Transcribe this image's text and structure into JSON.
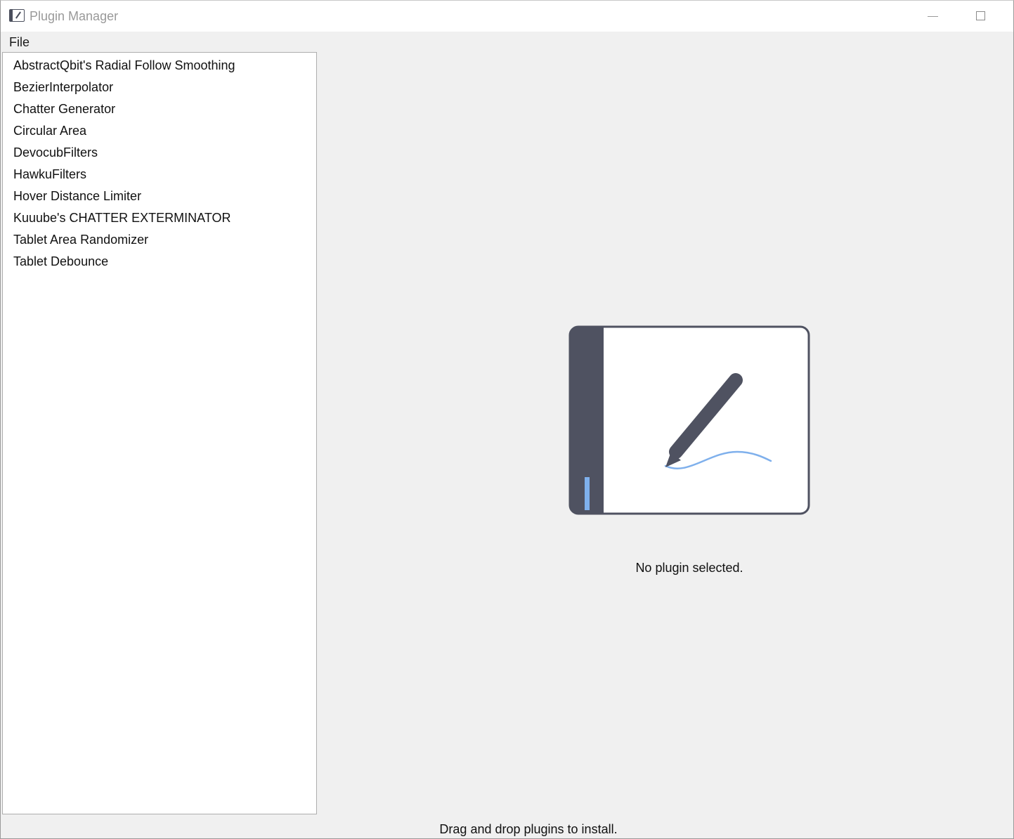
{
  "window": {
    "title": "Plugin Manager"
  },
  "menu": {
    "items": [
      {
        "label": "File"
      }
    ]
  },
  "plugins": [
    {
      "label": "AbstractQbit's Radial Follow Smoothing"
    },
    {
      "label": "BezierInterpolator"
    },
    {
      "label": "Chatter Generator"
    },
    {
      "label": "Circular Area"
    },
    {
      "label": "DevocubFilters"
    },
    {
      "label": "HawkuFilters"
    },
    {
      "label": "Hover Distance Limiter"
    },
    {
      "label": "Kuuube's CHATTER EXTERMINATOR"
    },
    {
      "label": "Tablet Area Randomizer"
    },
    {
      "label": "Tablet Debounce"
    }
  ],
  "details": {
    "empty_message": "No plugin selected.",
    "illustration_icon": "tablet-pen-icon"
  },
  "status": {
    "text": "Drag and drop plugins to install."
  },
  "colors": {
    "tablet_dark": "#4f5261",
    "tablet_accent": "#7fb0ec",
    "background": "#f0f0f0"
  }
}
